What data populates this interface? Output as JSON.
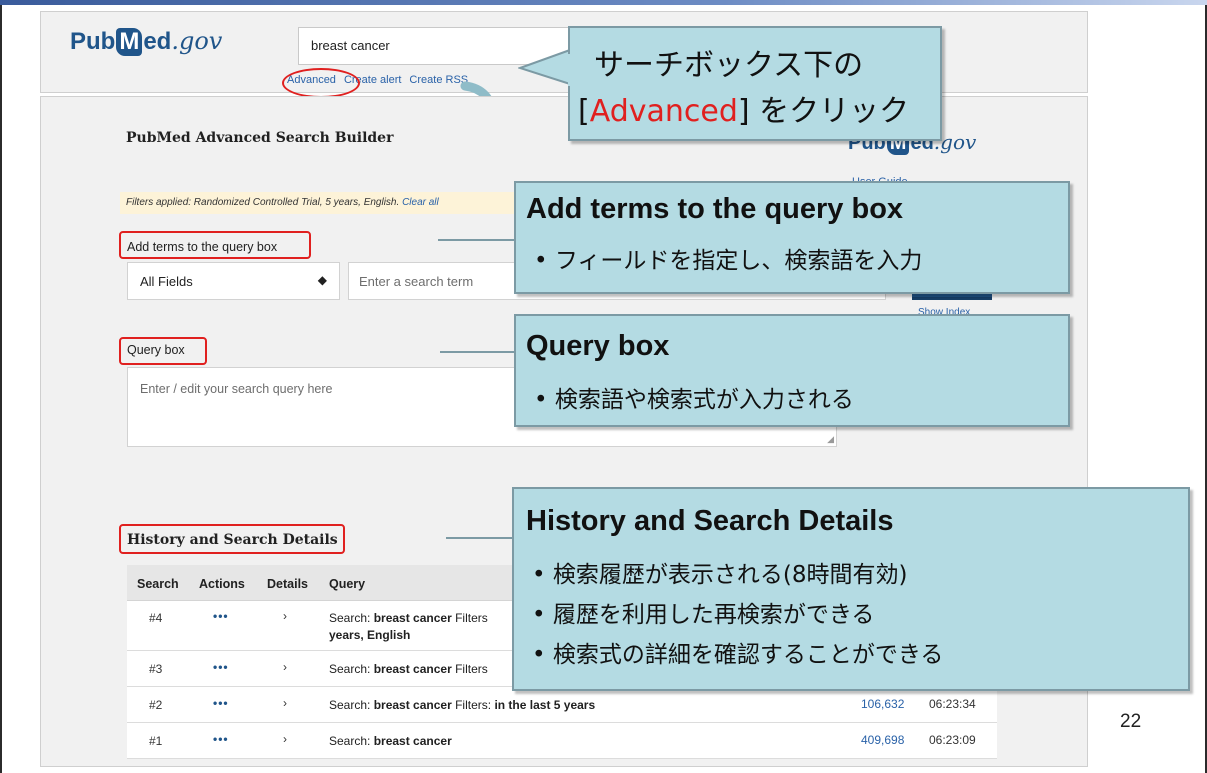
{
  "header": {
    "logo_prefix": "Pub",
    "logo_m": "M",
    "logo_suffix": "ed",
    "logo_gov": ".gov",
    "search_value": "breast cancer",
    "links": [
      "Advanced",
      "Create alert",
      "Create RSS"
    ]
  },
  "builder": {
    "title": "PubMed Advanced Search Builder",
    "user_guide": "User Guide",
    "filters_text": "Filters applied: Randomized Controlled Trial, 5 years, English.",
    "filters_clear": "Clear all",
    "add_terms_label": "Add terms to the query box",
    "field_select_value": "All Fields",
    "term_placeholder": "Enter a search term",
    "show_index": "Show Index",
    "query_box_label": "Query box",
    "query_placeholder": "Enter / edit your search query here",
    "history_label": "History and Search Details"
  },
  "history": {
    "columns": [
      "Search",
      "Actions",
      "Details",
      "Query"
    ],
    "rows": [
      {
        "num": "#4",
        "actions": "•••",
        "details": "›",
        "query_prefix": "Search:",
        "query_term": "breast cancer",
        "filters_prefix": "Filters",
        "filters_value": "years, English",
        "count": "",
        "time": ""
      },
      {
        "num": "#3",
        "actions": "•••",
        "details": "›",
        "query_prefix": "Search:",
        "query_term": "breast cancer",
        "filters_prefix": "Filters",
        "filters_value": "",
        "count": "",
        "time": ""
      },
      {
        "num": "#2",
        "actions": "•••",
        "details": "›",
        "query_prefix": "Search:",
        "query_term": "breast cancer",
        "filters_prefix": "Filters:",
        "filters_value": "in the last 5 years",
        "count": "106,632",
        "time": "06:23:34"
      },
      {
        "num": "#1",
        "actions": "•••",
        "details": "›",
        "query_prefix": "Search:",
        "query_term": "breast cancer",
        "filters_prefix": "",
        "filters_value": "",
        "count": "409,698",
        "time": "06:23:09"
      }
    ]
  },
  "callouts": {
    "advanced": {
      "line1": "サーチボックス下の",
      "bracket_open": "[",
      "highlight": "Advanced",
      "rest": "] をクリック"
    },
    "add_terms": {
      "title": "Add terms to the query box",
      "bullet": "• フィールドを指定し、検索語を入力"
    },
    "query_box": {
      "title": "Query box",
      "bullet": "• 検索語や検索式が入力される"
    },
    "history": {
      "title": "History and Search Details",
      "bullets": [
        "• 検索履歴が表示される(8時間有効)",
        "• 履歴を利用した再検索ができる",
        "• 検索式の詳細を確認することができる"
      ]
    }
  },
  "page_number": "22",
  "colors": {
    "accent": "#20558a",
    "callout_bg": "#b4dbe3",
    "highlight_red": "#e0201f"
  }
}
